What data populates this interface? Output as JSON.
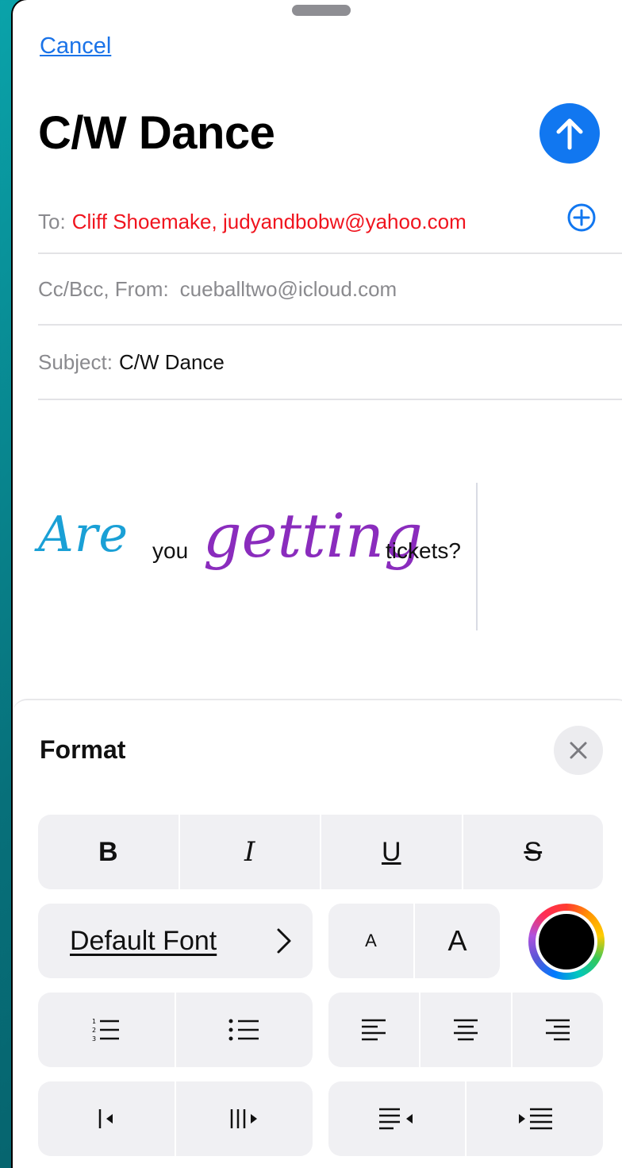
{
  "compose": {
    "cancel_label": "Cancel",
    "title": "C/W Dance",
    "to_label": "To:",
    "recipients": "Cliff Shoemake, judyandbobw@yahoo.com",
    "ccbcc_label": "Cc/Bcc, From:",
    "from_value": "cueballtwo@icloud.com",
    "subject_label": "Subject:",
    "subject_value": "C/W Dance",
    "recipient_color": "#f0141e",
    "accent": "#1177f0"
  },
  "body": {
    "words": [
      "Are",
      "you",
      "getting",
      "tickets?"
    ],
    "word_colors": {
      "Are": "#1aa0d6",
      "getting": "#8a2cbd"
    }
  },
  "format_panel": {
    "title": "Format",
    "style_buttons": [
      "B",
      "I",
      "U",
      "S"
    ],
    "font_label": "Default Font",
    "font_chevron": "›",
    "size_small": "A",
    "size_large": "A",
    "text_color": "#000000",
    "icons": {
      "numbered_list": "numbered-list-icon",
      "bulleted_list": "bulleted-list-icon",
      "align_left": "align-left-icon",
      "align_center": "align-center-icon",
      "align_right": "align-right-icon",
      "indent_decrease": "outdent-icon",
      "indent_increase": "indent-icon",
      "quote_decrease": "quote-decrease-icon",
      "quote_increase": "quote-increase-icon"
    }
  }
}
